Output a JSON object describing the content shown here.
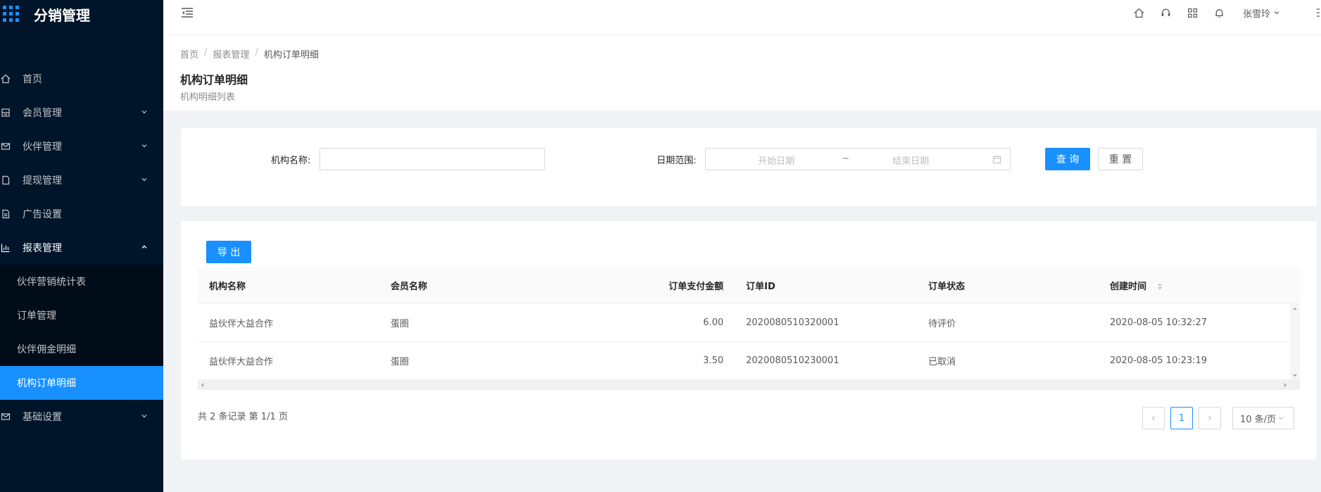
{
  "app": {
    "title": "分销管理"
  },
  "sidebar": {
    "items": [
      {
        "label": "首页",
        "icon": "home-icon"
      },
      {
        "label": "会员管理",
        "icon": "member-icon"
      },
      {
        "label": "伙伴管理",
        "icon": "mail-icon"
      },
      {
        "label": "提现管理",
        "icon": "file-icon"
      },
      {
        "label": "广告设置",
        "icon": "file-text-icon"
      },
      {
        "label": "报表管理",
        "icon": "bar-chart-icon"
      },
      {
        "label": "基础设置",
        "icon": "mail-icon"
      }
    ],
    "report_sub": [
      {
        "label": "伙伴营销统计表"
      },
      {
        "label": "订单管理"
      },
      {
        "label": "伙伴佣金明细"
      },
      {
        "label": "机构订单明细"
      }
    ]
  },
  "header": {
    "user_name": "张雪玲"
  },
  "breadcrumb": {
    "home": "首页",
    "section": "报表管理",
    "current": "机构订单明细"
  },
  "page": {
    "title": "机构订单明细",
    "subtitle": "机构明细列表"
  },
  "search": {
    "org_label": "机构名称:",
    "org_value": "",
    "date_label": "日期范围:",
    "start_placeholder": "开始日期",
    "range_sep": "~",
    "end_placeholder": "结束日期",
    "query_label": "查 询",
    "reset_label": "重 置"
  },
  "table": {
    "export_label": "导 出",
    "columns": [
      "机构名称",
      "会员名称",
      "订单支付金额",
      "订单ID",
      "订单状态",
      "创建时间"
    ],
    "rows": [
      [
        "益伙伴大益合作",
        "蛋圈",
        "6.00",
        "2020080510320001",
        "待评价",
        "2020-08-05 10:32:27"
      ],
      [
        "益伙伴大益合作",
        "蛋圈",
        "3.50",
        "2020080510230001",
        "已取消",
        "2020-08-05 10:23:19"
      ]
    ]
  },
  "pagination": {
    "total_text": "共 2 条记录 第 1/1 页",
    "current_page": "1",
    "page_size": "10 条/页"
  },
  "colors": {
    "sidebar_bg": "#001529",
    "accent": "#1890ff",
    "submenu_bg": "#000c17"
  }
}
